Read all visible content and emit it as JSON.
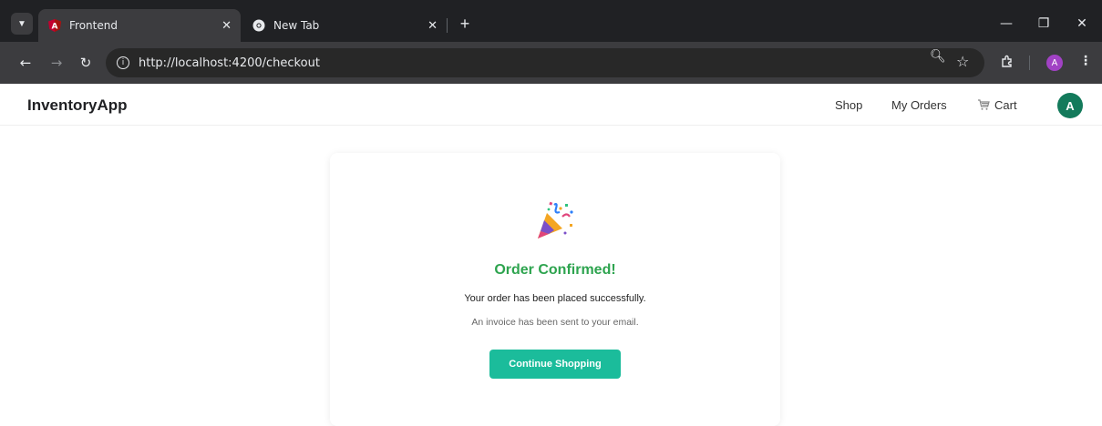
{
  "browser": {
    "tabs": [
      {
        "title": "Frontend",
        "active": true
      },
      {
        "title": "New Tab",
        "active": false
      }
    ],
    "url": "http://localhost:4200/checkout",
    "profile_initial": "A"
  },
  "app": {
    "brand": "InventoryApp",
    "nav": {
      "shop": "Shop",
      "orders": "My Orders",
      "cart": "Cart"
    },
    "avatar_initial": "A"
  },
  "confirmation": {
    "icon": "party-popper-icon",
    "title": "Order Confirmed!",
    "message": "Your order has been placed successfully.",
    "note": "An invoice has been sent to your email.",
    "button": "Continue Shopping"
  },
  "colors": {
    "success": "#2ea44f",
    "button": "#1bbc9b",
    "avatar": "#137a5b"
  }
}
